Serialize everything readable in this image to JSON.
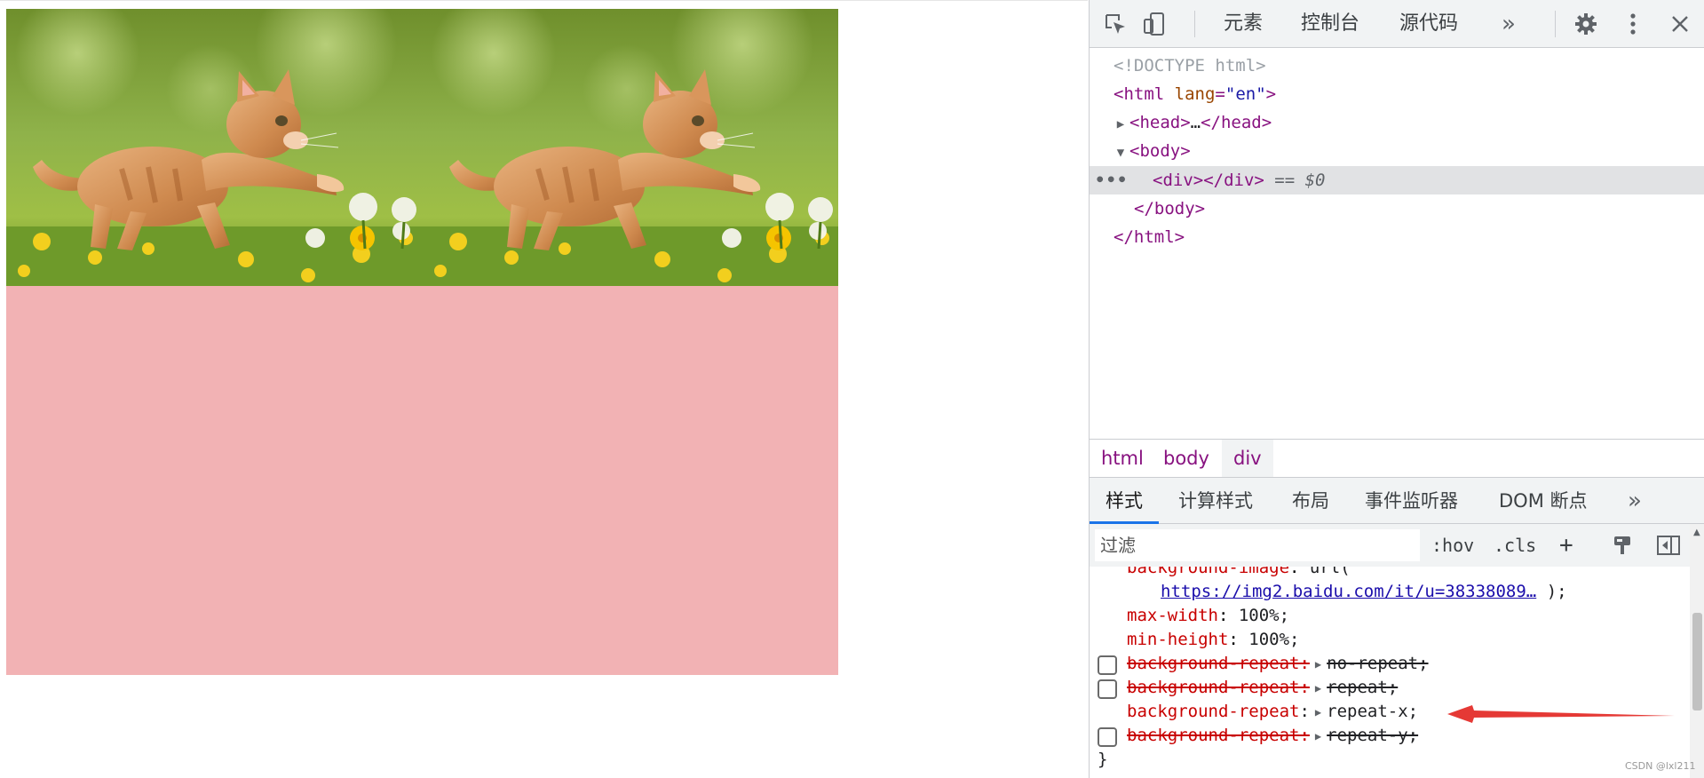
{
  "page": {
    "viewport_div": {
      "background": "#f2b2b4",
      "background_repeat": "repeat-x"
    }
  },
  "devtools": {
    "toolbar": {
      "icons": [
        "inspect-cursor-icon",
        "device-toggle-icon",
        "more-tabs-icon",
        "settings-icon",
        "more-vert-icon",
        "close-icon"
      ],
      "tabs": [
        {
          "label": "元素",
          "active": true
        },
        {
          "label": "控制台",
          "active": false
        },
        {
          "label": "源代码",
          "active": false
        }
      ],
      "more_tabs": "»"
    },
    "dom": {
      "doctype": "<!DOCTYPE html>",
      "html_open": "<html",
      "html_attr_name": "lang",
      "html_attr_val": "\"en\"",
      "head": "<head>",
      "head_ellipsis": "…",
      "head_close": "</head>",
      "body_open": "<body>",
      "div": "<div></div>",
      "div_ref": "== $0",
      "body_close": "</body>",
      "html_close": "</html>",
      "row_dots": "•••"
    },
    "breadcrumb": [
      "html",
      "body",
      "div"
    ],
    "subtabs": [
      {
        "label": "样式",
        "active": true
      },
      {
        "label": "计算样式",
        "active": false
      },
      {
        "label": "布局",
        "active": false
      },
      {
        "label": "事件监听器",
        "active": false
      },
      {
        "label": "DOM 断点",
        "active": false
      }
    ],
    "subtabs_more": "»",
    "filter": {
      "placeholder": "过滤",
      "hov": ":hov",
      "cls": ".cls",
      "add": "+"
    },
    "styles": {
      "bg_image_prop": "background-image",
      "bg_image_val": "url(",
      "bg_image_link": "https://img2.baidu.com/it/u=38338089…",
      "bg_image_close": ");",
      "max_width_prop": "max-width",
      "max_width_val": "100%;",
      "min_height_prop": "min-height",
      "min_height_val": "100%;",
      "rules": [
        {
          "prop": "background-repeat",
          "value": "no-repeat;",
          "struck": true,
          "checkbox": true
        },
        {
          "prop": "background-repeat",
          "value": "repeat;",
          "struck": true,
          "checkbox": true
        },
        {
          "prop": "background-repeat",
          "value": "repeat-x;",
          "struck": false,
          "checkbox": false
        },
        {
          "prop": "background-repeat",
          "value": "repeat-y;",
          "struck": true,
          "checkbox": true
        }
      ],
      "closing_brace": "}"
    },
    "annotation_color": "#e53935"
  },
  "watermark": "CSDN @lxl211"
}
